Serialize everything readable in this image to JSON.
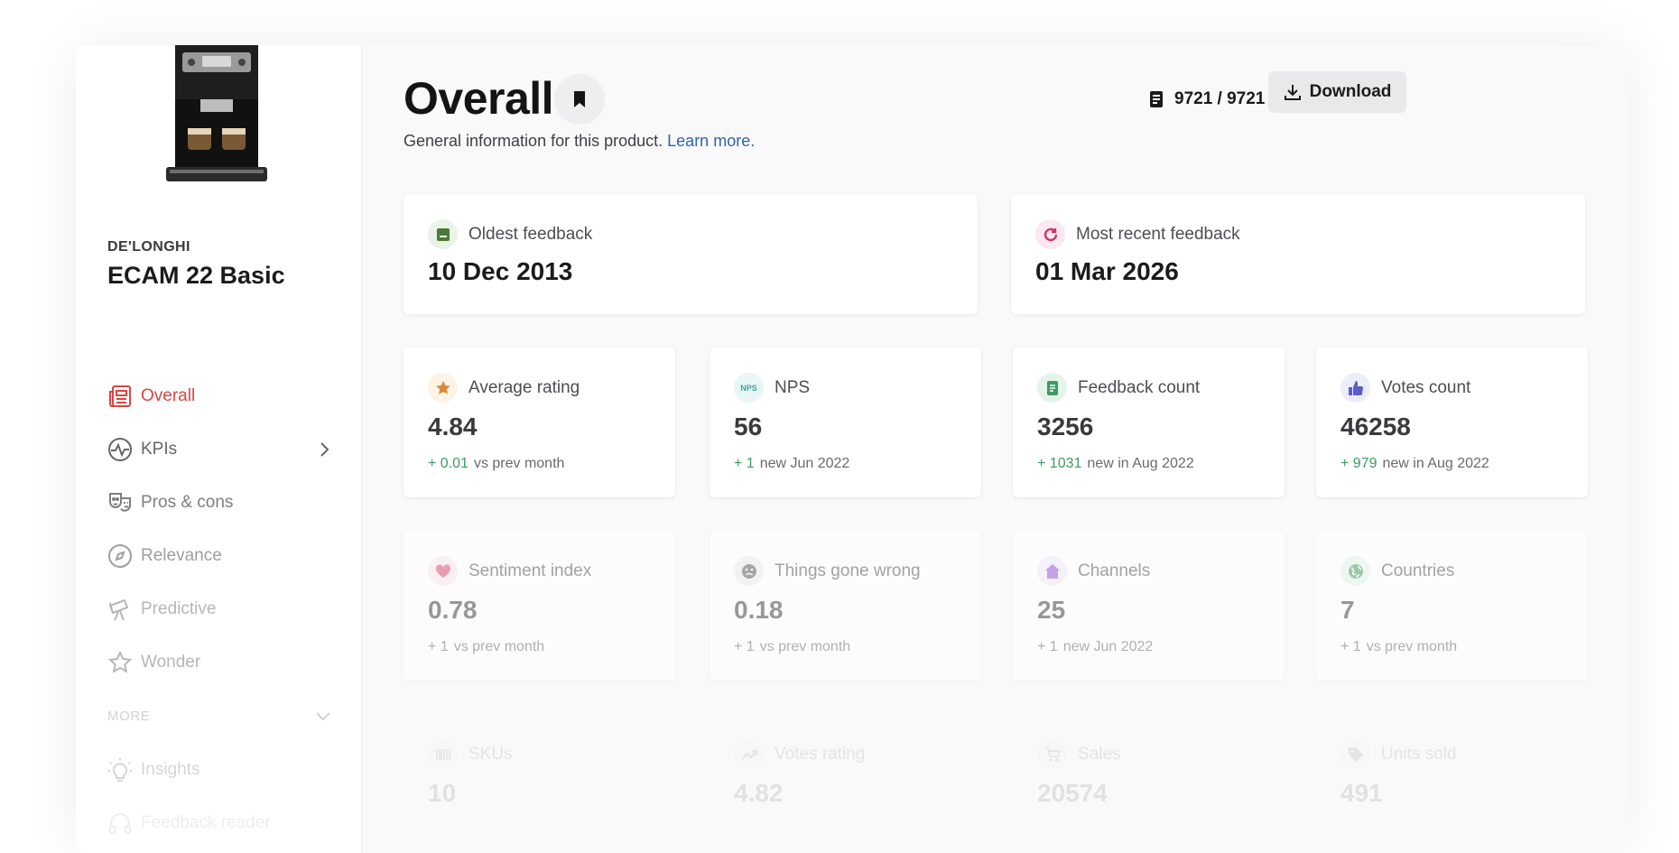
{
  "product": {
    "brand": "DE'LONGHI",
    "model": "ECAM 22 Basic"
  },
  "sidebar": {
    "items": [
      {
        "label": "Overall",
        "icon": "newspaper-icon",
        "active": true
      },
      {
        "label": "KPIs",
        "icon": "activity-icon",
        "has_submenu": true
      },
      {
        "label": "Pros & cons",
        "icon": "masks-icon"
      },
      {
        "label": "Relevance",
        "icon": "compass-icon"
      },
      {
        "label": "Predictive",
        "icon": "telescope-icon"
      },
      {
        "label": "Wonder",
        "icon": "star-icon"
      }
    ],
    "more_label": "MORE",
    "more_items": [
      {
        "label": "Insights",
        "icon": "lightbulb-icon"
      },
      {
        "label": "Feedback reader",
        "icon": "headphones-icon"
      }
    ]
  },
  "header": {
    "title": "Overall",
    "subtitle": "General information for this product.",
    "learn_more": "Learn more.",
    "count": "9721 / 9721",
    "download_label": "Download"
  },
  "summary": {
    "oldest_label": "Oldest feedback",
    "oldest_value": "10 Dec 2013",
    "recent_label": "Most recent feedback",
    "recent_value": "01 Mar 2026"
  },
  "kpis": [
    {
      "label": "Average rating",
      "value": "4.84",
      "delta": "+ 0.01",
      "note": "vs prev month",
      "icon": "star-icon",
      "color": "#d98a3a"
    },
    {
      "label": "NPS",
      "value": "56",
      "delta": "+ 1",
      "note": "new Jun 2022",
      "icon": "nps-icon",
      "icon_text": "NPS",
      "color": "#3aa6a0"
    },
    {
      "label": "Feedback count",
      "value": "3256",
      "delta": "+ 1031",
      "note": "new in Aug 2022",
      "icon": "document-icon",
      "color": "#3f9b63"
    },
    {
      "label": "Votes count",
      "value": "46258",
      "delta": "+ 979",
      "note": "new in Aug 2022",
      "icon": "thumbs-up-icon",
      "color": "#5b5fc7"
    },
    {
      "label": "Sentiment index",
      "value": "0.78",
      "delta": "+ 1",
      "note": "vs prev month",
      "icon": "heart-icon",
      "color": "#d6456a"
    },
    {
      "label": "Things gone wrong",
      "value": "0.18",
      "delta": "+ 1",
      "note": "vs prev month",
      "icon": "sad-face-icon",
      "color": "#555555"
    },
    {
      "label": "Channels",
      "value": "25",
      "delta": "+ 1",
      "note": "new Jun 2022",
      "icon": "home-icon",
      "color": "#8a4fd0"
    },
    {
      "label": "Countries",
      "value": "7",
      "delta": "+ 1",
      "note": "vs prev month",
      "icon": "globe-icon",
      "color": "#3f9b63"
    },
    {
      "label": "SKUs",
      "value": "10",
      "icon": "barcode-icon",
      "color": "#555555"
    },
    {
      "label": "Votes rating",
      "value": "4.82",
      "icon": "trend-up-icon",
      "color": "#555555"
    },
    {
      "label": "Sales",
      "value": "20574",
      "icon": "cart-icon",
      "color": "#555555"
    },
    {
      "label": "Units sold",
      "value": "491",
      "icon": "tag-icon",
      "color": "#555555"
    }
  ]
}
